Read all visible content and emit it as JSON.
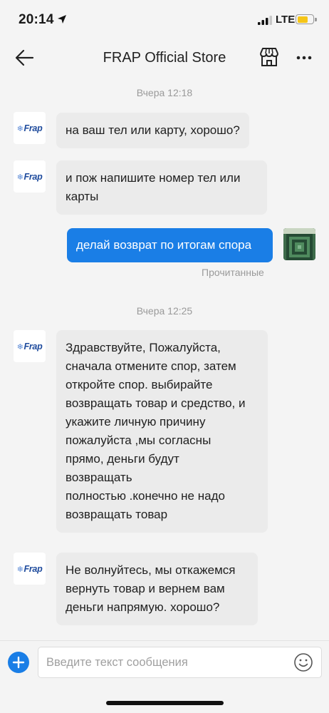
{
  "status_bar": {
    "time": "20:14",
    "network": "LTE",
    "battery_color": "#f5c518"
  },
  "header": {
    "title": "FRAP Official Store",
    "back_icon": "arrow-left-icon",
    "store_icon": "storefront-icon",
    "more_icon": "more-horizontal-icon"
  },
  "seller": {
    "logo_text": "Frap"
  },
  "chat": {
    "timestamp_1": "Вчера 12:18",
    "msg_1": "на ваш тел или карту, хорошо?",
    "msg_2_line_1": "и пож напишите номер тел или",
    "msg_2_line_2": "карты",
    "msg_3": "делай возврат по итогам спора",
    "msg_3_status": "Прочитанные",
    "timestamp_2": "Вчера 12:25",
    "msg_4_lines": [
      "Здравствуйте, Пожалуйста,",
      "сначала отмените спор, затем",
      "откройте спор. выбирайте",
      "возвращать товар и средство, и",
      "укажите личную причину",
      "пожалуйста ,мы согласны",
      "прямо, деньги будут",
      "возвращать",
      "полностью .конечно не надо",
      "возвращать товар"
    ],
    "msg_5_lines": [
      "Не волнуйтесь, мы откажемся",
      "вернуть товар и вернем вам",
      "деньги напрямую. хорошо?"
    ]
  },
  "input": {
    "placeholder": "Введите текст сообщения",
    "plus_icon": "plus-icon",
    "emoji_icon": "emoji-smile-icon"
  },
  "colors": {
    "accent": "#1a7ee6",
    "incoming_bubble": "#ebebeb",
    "background": "#f4f4f4"
  }
}
